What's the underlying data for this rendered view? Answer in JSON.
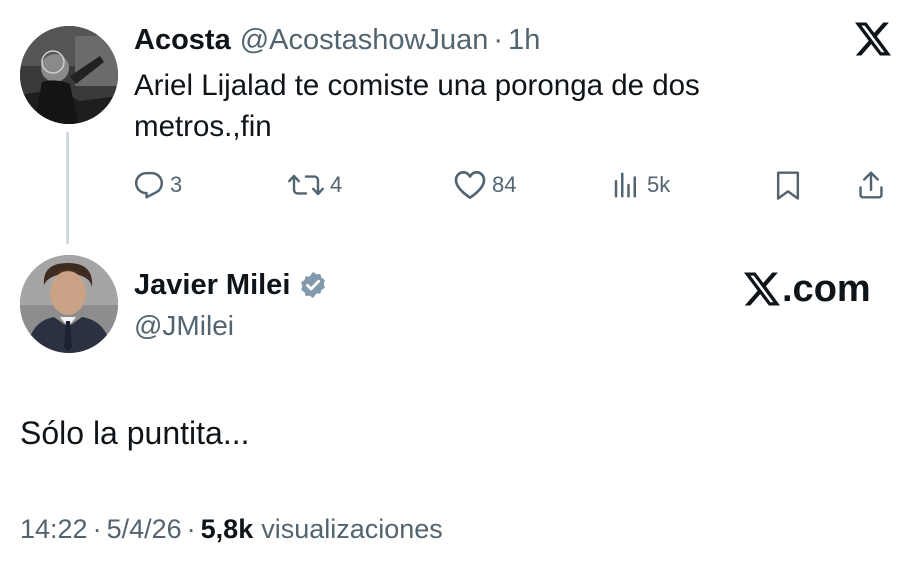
{
  "reply_tweet": {
    "author_name": "Acosta",
    "author_handle": "@AcostashowJuan",
    "separator": "·",
    "time": "1h",
    "text": "Ariel Lijalad te comiste una poronga de dos metros.,fin",
    "actions": {
      "replies": "3",
      "reposts": "4",
      "likes": "84",
      "views": "5k"
    }
  },
  "main_tweet": {
    "author_name": "Javier Milei",
    "author_handle": "@JMilei",
    "verified_badge_color": "#829aab",
    "text": "Sólo la puntita...",
    "time": "14:22",
    "separator": "·",
    "date": "5/4/26",
    "views_count": "5,8k",
    "views_label": "visualizaciones"
  },
  "watermark": {
    "domain_suffix": ".com"
  },
  "colors": {
    "text_primary": "#0f1419",
    "text_secondary": "#536471",
    "thread_line": "#cfd9de"
  }
}
